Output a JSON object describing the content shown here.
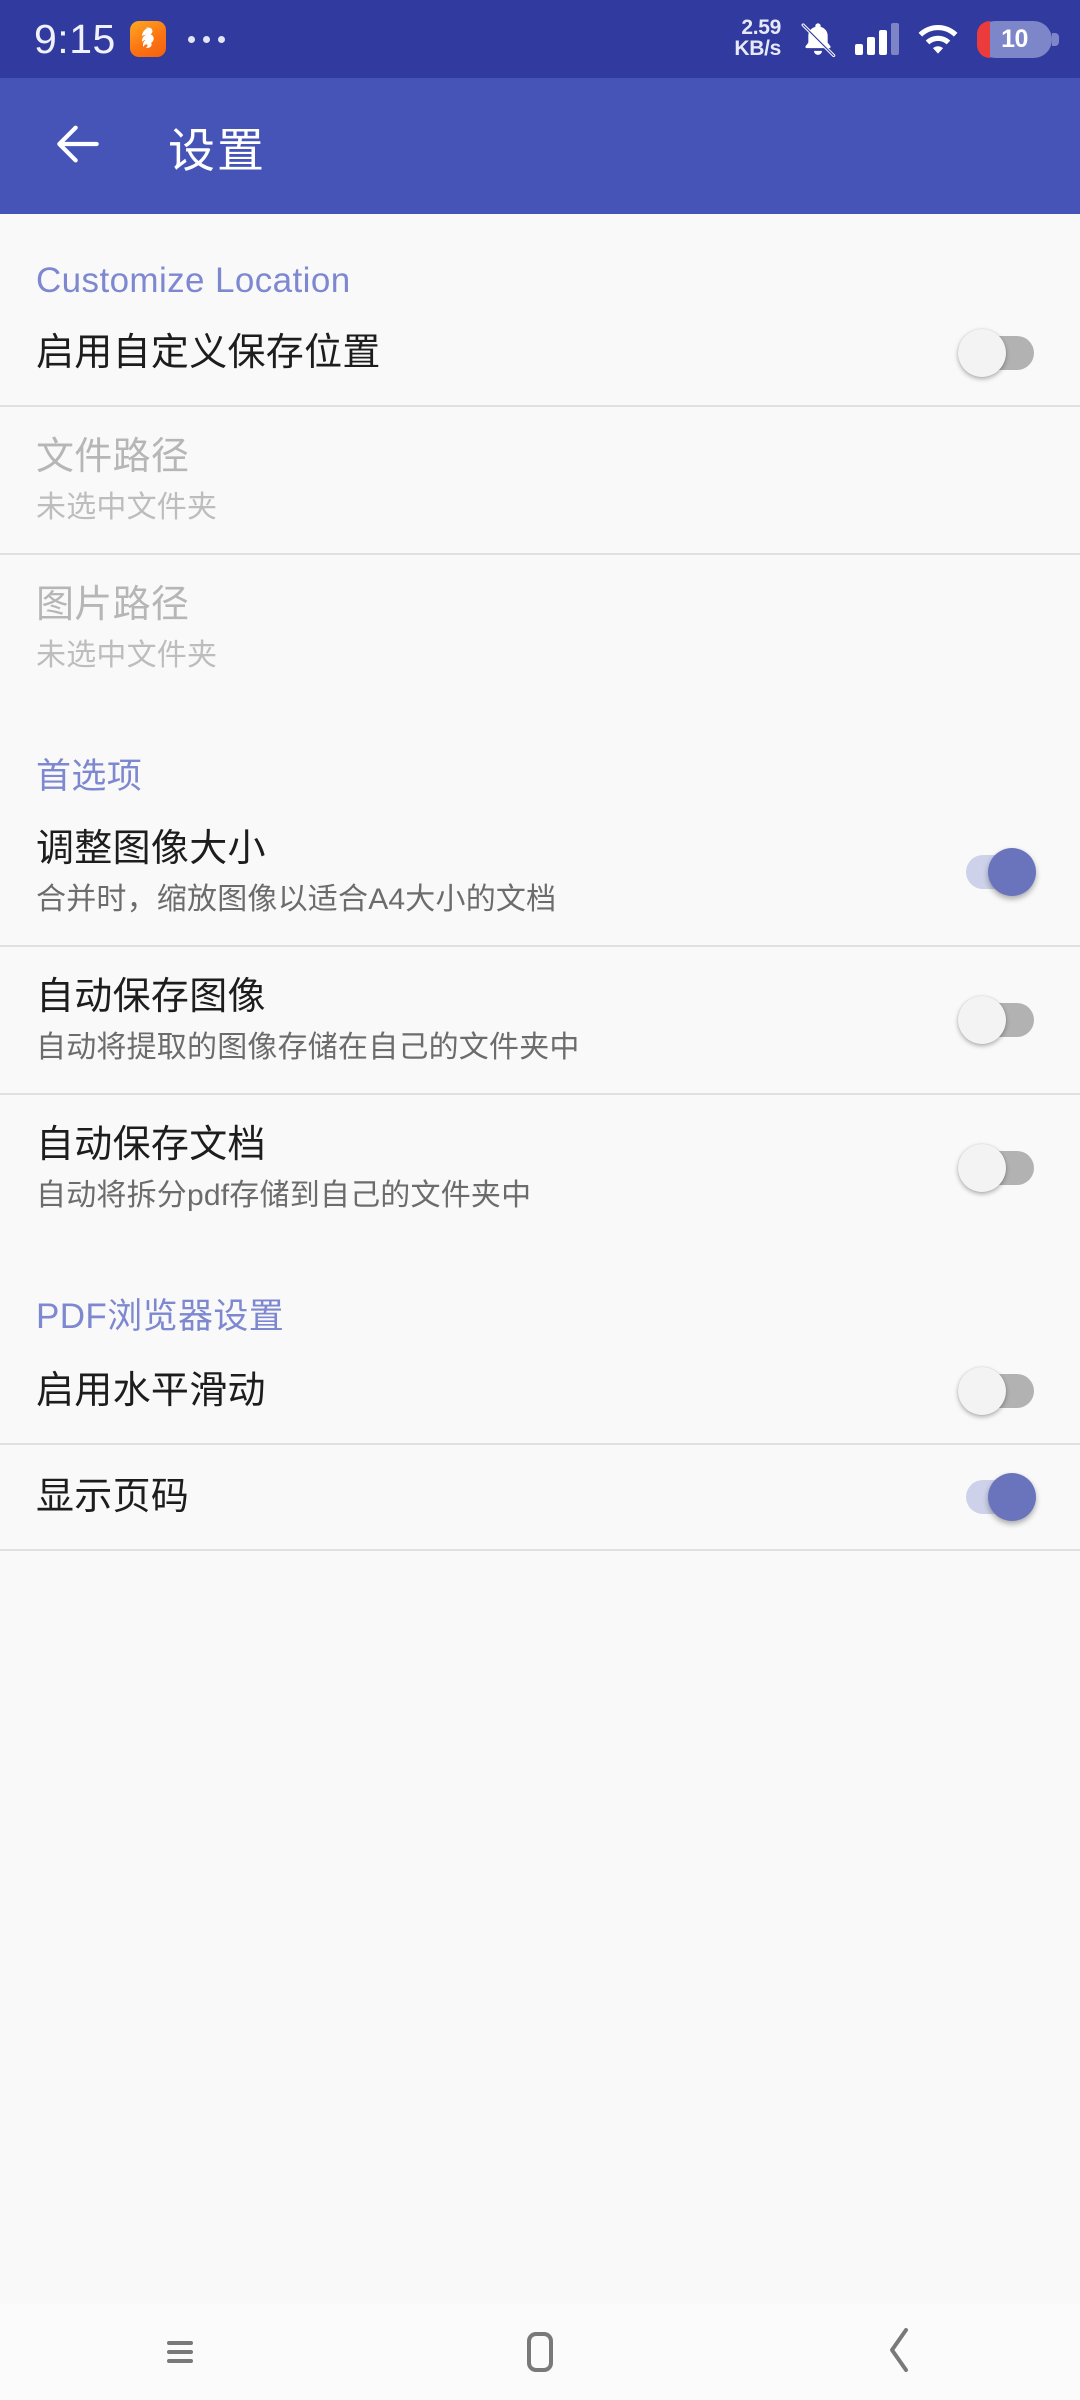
{
  "status_bar": {
    "time": "9:15",
    "app_icon": "uc-browser-icon",
    "overflow": "more-dots-icon",
    "net_speed_value": "2.59",
    "net_speed_unit": "KB/s",
    "silent_icon": "bell-muted-icon",
    "signal_icon": "cellular-signal-icon",
    "signal_bars_filled": 3,
    "signal_bars_total": 4,
    "wifi_icon": "wifi-icon",
    "battery_level": "10",
    "battery_icon": "battery-icon",
    "colors": {
      "status_bg": "#313a9e",
      "battery_low": "#ec3b3b",
      "battery_fill": "#7d86c9"
    }
  },
  "app_bar": {
    "back_icon": "arrow-left-icon",
    "title": "设置",
    "bg_color": "#4654b8"
  },
  "sections": [
    {
      "header": "Customize Location",
      "rows": [
        {
          "title": "启用自定义保存位置",
          "subtitle": "",
          "control": "switch",
          "state": "off",
          "disabled": false
        },
        {
          "title": "文件路径",
          "subtitle": "未选中文件夹",
          "control": "none",
          "state": "",
          "disabled": true
        },
        {
          "title": "图片路径",
          "subtitle": "未选中文件夹",
          "control": "none",
          "state": "",
          "disabled": true
        }
      ]
    },
    {
      "header": "首选项",
      "rows": [
        {
          "title": "调整图像大小",
          "subtitle": "合并时，缩放图像以适合A4大小的文档",
          "control": "switch",
          "state": "on",
          "disabled": false
        },
        {
          "title": "自动保存图像",
          "subtitle": "自动将提取的图像存储在自己的文件夹中",
          "control": "switch",
          "state": "off",
          "disabled": false
        },
        {
          "title": "自动保存文档",
          "subtitle": "自动将拆分pdf存储到自己的文件夹中",
          "control": "switch",
          "state": "off",
          "disabled": false
        }
      ]
    },
    {
      "header": "PDF浏览器设置",
      "rows": [
        {
          "title": "启用水平滑动",
          "subtitle": "",
          "control": "switch",
          "state": "off",
          "disabled": false
        },
        {
          "title": "显示页码",
          "subtitle": "",
          "control": "switch",
          "state": "on",
          "disabled": false
        }
      ]
    }
  ],
  "nav_bar": {
    "recents_icon": "recents-icon",
    "home_icon": "home-icon",
    "back_icon": "back-chevron-icon"
  },
  "theme": {
    "section_header_color": "#7d88d1",
    "switch_on_color": "#6a74bd",
    "switch_on_track": "#cdd2ea",
    "switch_off_track": "#b2b2b2",
    "content_bg": "#f9f9f9",
    "divider": "#e0e0e0"
  }
}
